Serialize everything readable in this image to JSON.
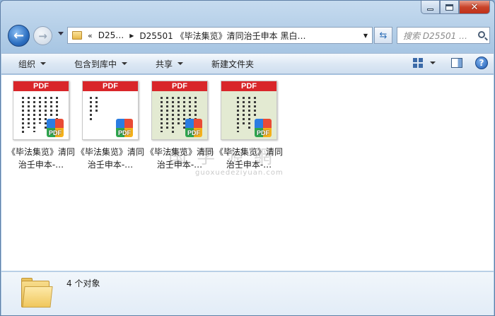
{
  "window": {
    "caption_buttons": [
      "minimize",
      "maximize",
      "close"
    ]
  },
  "address_bar": {
    "overflow_chevron": "«",
    "crumbs": [
      "D25…",
      "D25501 《毕法集览》清同治壬申本  黑白…"
    ],
    "search_placeholder": "搜索 D25501 …"
  },
  "toolbar": {
    "organize": "组织",
    "include_in_library": "包含到库中",
    "share": "共享",
    "new_folder": "新建文件夹"
  },
  "files": [
    {
      "name": "《毕法集览》清同治壬申本-…",
      "badge": "PDF",
      "page_color": "#ffffff"
    },
    {
      "name": "《毕法集览》清同治壬申本-…",
      "badge": "PDF",
      "page_color": "#ffffff"
    },
    {
      "name": "《毕法集览》清同治壬申本-…",
      "badge": "PDF",
      "page_color": "#e3ead2"
    },
    {
      "name": "《毕法集览》清同治壬申本-…",
      "badge": "PDF",
      "page_color": "#e3ead2"
    }
  ],
  "pdf_label": "PDF",
  "watermark": {
    "big": "国 学 源 網",
    "small": "guoxuedeziyuan.com"
  },
  "status": {
    "count": "4 个对象"
  },
  "colors": {
    "pdf_red": "#d9262a",
    "accent": "#2c6fc1"
  }
}
